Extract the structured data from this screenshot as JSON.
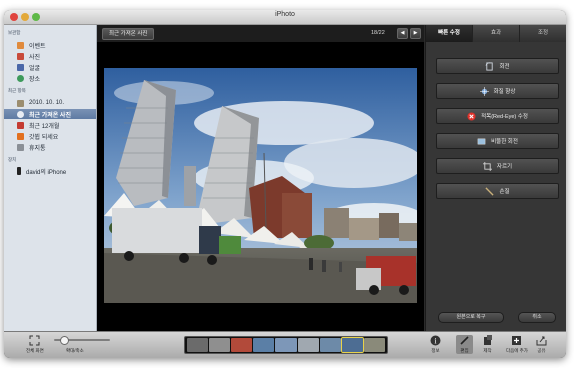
{
  "window": {
    "title": "iPhoto"
  },
  "sidebar": {
    "sections": [
      {
        "header": "보관함",
        "items": [
          {
            "label": "이벤트",
            "icon": "events-icon",
            "color": "#e08a3c"
          },
          {
            "label": "사진",
            "icon": "photos-icon",
            "color": "#c84a3a"
          },
          {
            "label": "얼굴",
            "icon": "faces-icon",
            "color": "#4a67a8"
          },
          {
            "label": "장소",
            "icon": "places-icon",
            "color": "#3d9a5b"
          }
        ]
      },
      {
        "header": "최근 항목",
        "items": [
          {
            "label": "2010. 10. 10.",
            "icon": "event-date-icon",
            "color": "#9b8d6f"
          },
          {
            "label": "최근 가져온 사진",
            "icon": "last-import-icon",
            "color": "#7d8fa8",
            "selected": true
          },
          {
            "label": "최근 12개월",
            "icon": "calendar-icon",
            "color": "#c43b32"
          },
          {
            "label": "갓뷥 되세요",
            "icon": "flag-icon",
            "color": "#e2701f"
          },
          {
            "label": "휴지통",
            "icon": "trash-icon",
            "color": "#8a8f96"
          }
        ]
      },
      {
        "header": "장치",
        "items": [
          {
            "label": "david의 iPhone",
            "icon": "iphone-icon",
            "color": "#222222"
          }
        ]
      }
    ]
  },
  "viewer": {
    "back_button": "최근 가져온 사진",
    "counter": "18/22",
    "prev_icon": "◀",
    "next_icon": "▶"
  },
  "edit_panel": {
    "tabs": [
      {
        "label": "빠른 수정",
        "active": true
      },
      {
        "label": "효과",
        "active": false
      },
      {
        "label": "조정",
        "active": false
      }
    ],
    "tools": [
      {
        "label": "회전",
        "icon": "rotate-icon",
        "color": "#cfd6df"
      },
      {
        "label": "화질 향상",
        "icon": "enhance-icon",
        "color": "#7fa8d8"
      },
      {
        "label": "적목(Red-Eye) 수정",
        "icon": "red-eye-icon",
        "color": "#e0312a"
      },
      {
        "label": "비뚤한 회전",
        "icon": "straighten-icon",
        "color": "#9cc0de"
      },
      {
        "label": "자르기",
        "icon": "crop-icon",
        "color": "#d2d2d2"
      },
      {
        "label": "손질",
        "icon": "retouch-icon",
        "color": "#c9b07a"
      }
    ],
    "revert_button": "원본으로 복구",
    "cancel_button": "취소"
  },
  "bottom_toolbar": {
    "left_tools": [
      {
        "label": "전체 화면",
        "icon": "fullscreen-icon"
      },
      {
        "label": "확대/축소",
        "icon": "zoom-icon"
      }
    ],
    "zoom_level": 0.12,
    "right_tools": [
      {
        "label": "정보",
        "icon": "info-icon"
      },
      {
        "label": "편집",
        "icon": "edit-icon",
        "active": true
      },
      {
        "label": "제작",
        "icon": "create-icon"
      },
      {
        "label": "다음에 추가",
        "icon": "add-to-icon"
      },
      {
        "label": "공유",
        "icon": "share-icon"
      }
    ],
    "filmstrip_count": 9,
    "filmstrip_selected": 7
  }
}
